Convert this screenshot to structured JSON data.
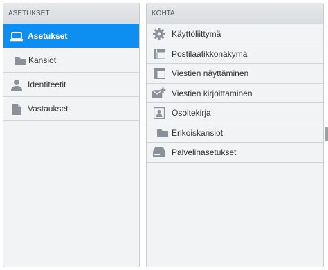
{
  "left_panel": {
    "header": "ASETUKSET",
    "items": [
      {
        "label": "Asetukset",
        "icon": "laptop-icon"
      },
      {
        "label": "Kansiot",
        "icon": "folder-icon"
      },
      {
        "label": "Identiteetit",
        "icon": "person-icon"
      },
      {
        "label": "Vastaukset",
        "icon": "document-icon"
      }
    ]
  },
  "right_panel": {
    "header": "KOHTA",
    "items": [
      {
        "label": "Käyttöliittymä",
        "icon": "gear-icon"
      },
      {
        "label": "Postilaatikkonäkymä",
        "icon": "layout-icon"
      },
      {
        "label": "Viestien näyttäminen",
        "icon": "window-icon"
      },
      {
        "label": "Viestien kirjoittaminen",
        "icon": "compose-icon"
      },
      {
        "label": "Osoitekirja",
        "icon": "contact-card-icon"
      },
      {
        "label": "Erikoiskansiot",
        "icon": "folder-icon"
      },
      {
        "label": "Palvelinasetukset",
        "icon": "server-icon"
      }
    ]
  },
  "colors": {
    "selected": "#0e8ef0",
    "icon_gray": "#8a9199"
  }
}
